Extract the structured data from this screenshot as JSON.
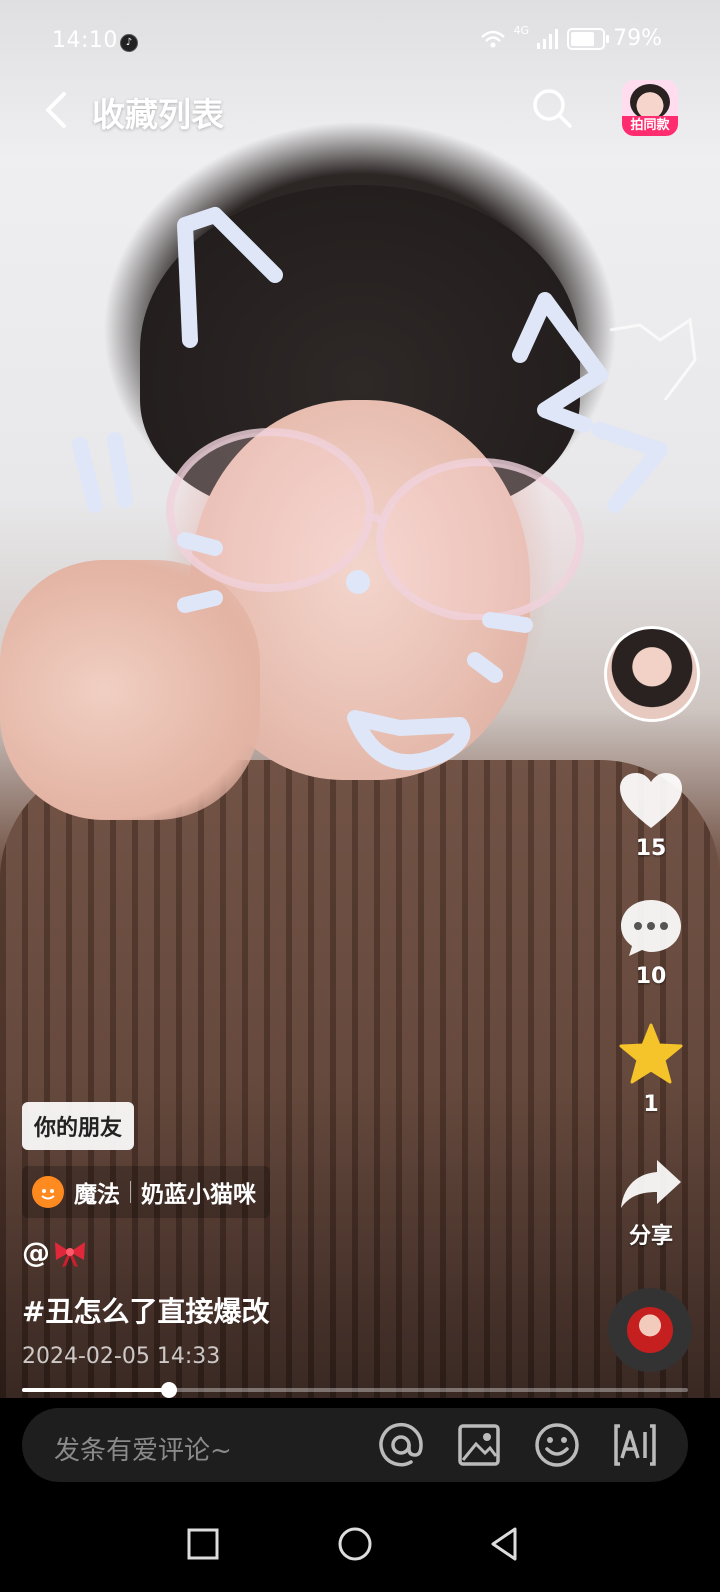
{
  "status_bar": {
    "time": "14:10",
    "network": "4G",
    "battery": "79%",
    "battery_level": 0.79
  },
  "header": {
    "title": "收藏列表",
    "same_style_tag": "拍同款"
  },
  "actions": {
    "like_count": "15",
    "comment_count": "10",
    "favorite_count": "1",
    "share_label": "分享"
  },
  "post": {
    "friend_badge": "你的朋友",
    "magic_label": "魔法",
    "magic_name": "奶蓝小猫咪",
    "mention": "@",
    "caption": "#丑怎么了直接爆改",
    "date": "2024-02-05 14:33",
    "progress": 0.22
  },
  "comment_bar": {
    "placeholder": "发条有爱评论~"
  },
  "colors": {
    "favorite_star": "#f5c42a",
    "same_tag": "#ff2d6f",
    "magic_icon": "#ff8a1f",
    "bow": "#e0283a"
  },
  "icons": [
    "back-icon",
    "search-icon",
    "heart-icon",
    "comment-icon",
    "star-icon",
    "share-icon",
    "at-icon",
    "image-icon",
    "emoji-icon",
    "ai-text-icon",
    "nav-square-icon",
    "nav-circle-icon",
    "nav-back-icon",
    "bow-emoji-icon",
    "wifi-icon",
    "signal-icon",
    "battery-icon"
  ]
}
